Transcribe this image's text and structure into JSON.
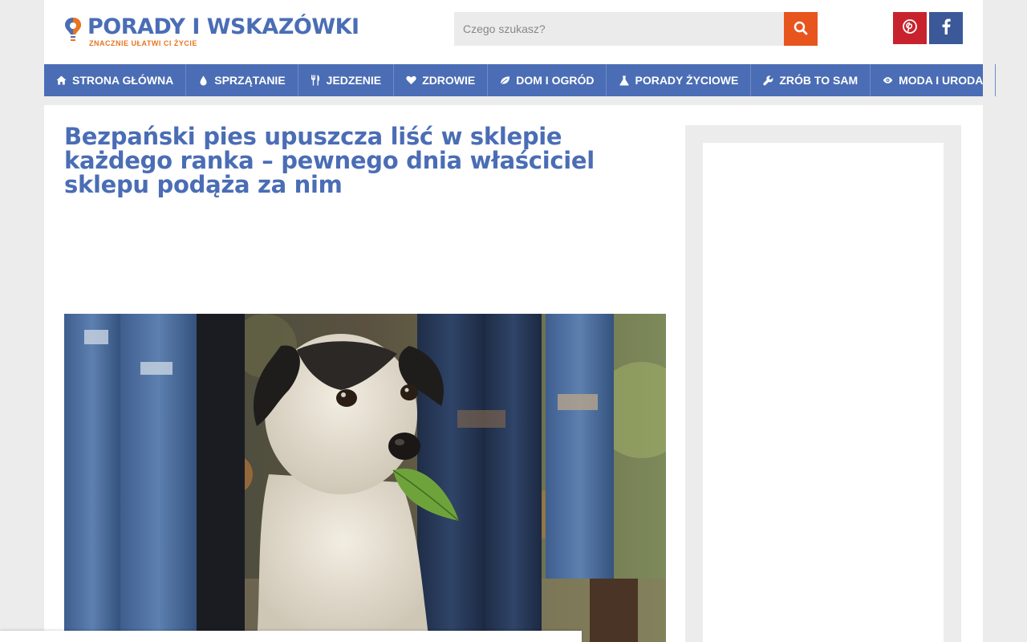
{
  "header": {
    "logo_title": "PORADY I WSKAZÓWKI",
    "logo_subtitle": "ZNACZNIE UŁATWI CI ŻYCIE",
    "search_placeholder": "Czego szukasz?",
    "search_icon": "search-icon",
    "social": [
      {
        "name": "pinterest",
        "icon": "pinterest-icon",
        "color": "#c8232c"
      },
      {
        "name": "facebook",
        "icon": "facebook-icon",
        "color": "#3b5998"
      }
    ]
  },
  "nav": {
    "items": [
      {
        "label": "STRONA GŁÓWNA",
        "icon": "home-icon"
      },
      {
        "label": "SPRZĄTANIE",
        "icon": "drop-icon"
      },
      {
        "label": "JEDZENIE",
        "icon": "cutlery-icon"
      },
      {
        "label": "ZDROWIE",
        "icon": "heart-icon"
      },
      {
        "label": "DOM I OGRÓD",
        "icon": "leaf-icon"
      },
      {
        "label": "PORADY ŻYCIOWE",
        "icon": "flask-icon"
      },
      {
        "label": "ZRÓB TO SAM",
        "icon": "wrench-icon"
      },
      {
        "label": "MODA I URODA",
        "icon": "eye-icon"
      }
    ]
  },
  "article": {
    "title": "Bezpański pies upuszcza liść w sklepie każdego ranka – pewnego dnia właściciel sklepu podąża za nim"
  },
  "colors": {
    "accent": "#4a6db5",
    "search_button": "#e8541e",
    "logo_subtitle": "#e8741e"
  }
}
